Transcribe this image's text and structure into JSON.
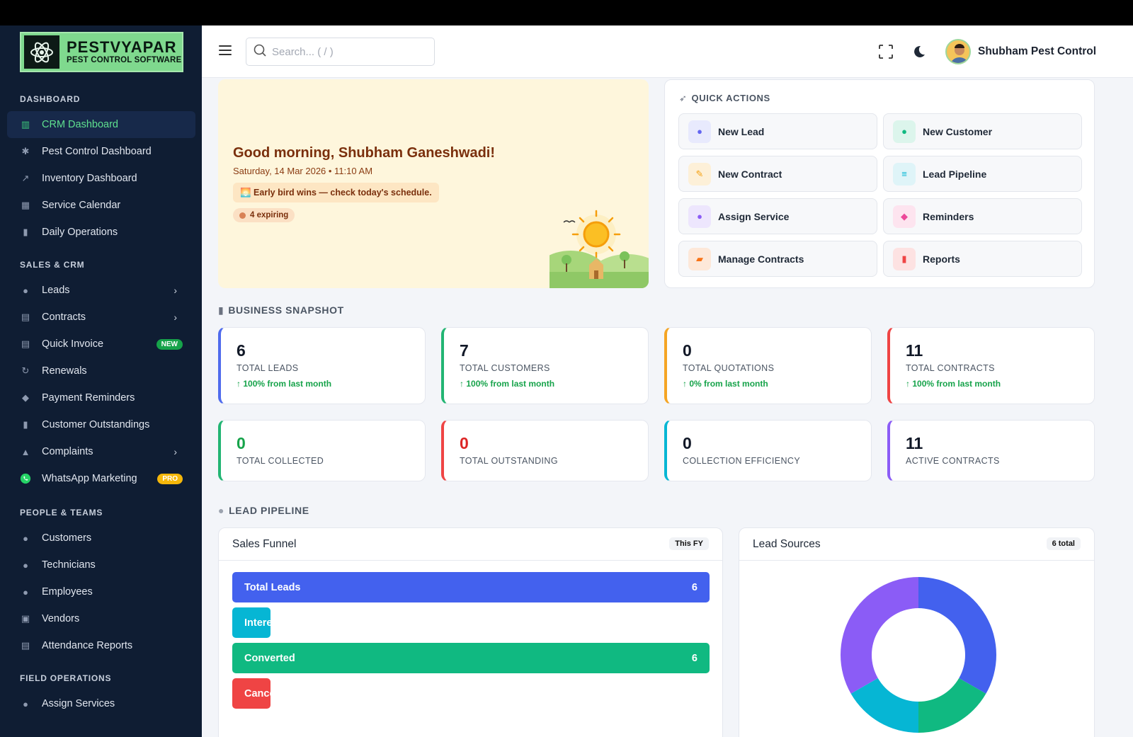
{
  "brand": {
    "line1": "PESTVYAPAR",
    "line2": "PEST CONTROL SOFTWARE"
  },
  "sidebar": {
    "sections": [
      {
        "title": "DASHBOARD",
        "items": [
          {
            "label": "CRM Dashboard",
            "icon": "bar-chart-icon",
            "active": true
          },
          {
            "label": "Pest Control Dashboard",
            "icon": "bug-icon"
          },
          {
            "label": "Inventory Dashboard",
            "icon": "trend-icon"
          },
          {
            "label": "Service Calendar",
            "icon": "calendar-icon"
          },
          {
            "label": "Daily Operations",
            "icon": "bars-icon"
          }
        ]
      },
      {
        "title": "SALES & CRM",
        "items": [
          {
            "label": "Leads",
            "icon": "user-icon",
            "chevron": true
          },
          {
            "label": "Contracts",
            "icon": "document-icon",
            "chevron": true
          },
          {
            "label": "Quick Invoice",
            "icon": "invoice-icon",
            "badge": "NEW"
          },
          {
            "label": "Renewals",
            "icon": "refresh-icon"
          },
          {
            "label": "Payment Reminders",
            "icon": "bell-icon"
          },
          {
            "label": "Customer Outstandings",
            "icon": "bars-icon"
          },
          {
            "label": "Complaints",
            "icon": "warning-icon",
            "chevron": true
          },
          {
            "label": "WhatsApp Marketing",
            "icon": "whatsapp-icon",
            "badge": "PRO"
          }
        ]
      },
      {
        "title": "PEOPLE & TEAMS",
        "items": [
          {
            "label": "Customers",
            "icon": "users-icon"
          },
          {
            "label": "Technicians",
            "icon": "technician-icon"
          },
          {
            "label": "Employees",
            "icon": "user-icon"
          },
          {
            "label": "Vendors",
            "icon": "vendor-icon"
          },
          {
            "label": "Attendance Reports",
            "icon": "report-icon"
          }
        ]
      },
      {
        "title": "FIELD OPERATIONS",
        "items": [
          {
            "label": "Assign Services",
            "icon": "assign-icon"
          }
        ]
      }
    ]
  },
  "header": {
    "search_placeholder": "Search... ( / )",
    "user_name": "Shubham Pest Control"
  },
  "greeting": {
    "title": "Good morning, Shubham Ganeshwadi!",
    "date": "Saturday, 14 Mar 2026 • 11:10 AM",
    "tip": "🌅 Early bird wins — check today's schedule.",
    "expiring": "4 expiring"
  },
  "quick_actions": {
    "title": "QUICK ACTIONS",
    "items": [
      {
        "label": "New Lead",
        "color": "#6366f1",
        "bg": "#e8eafd"
      },
      {
        "label": "New Customer",
        "color": "#10b981",
        "bg": "#dcf5ec"
      },
      {
        "label": "New Contract",
        "color": "#f59e0b",
        "bg": "#fdf0d8"
      },
      {
        "label": "Lead Pipeline",
        "color": "#06b6d4",
        "bg": "#dff4f8"
      },
      {
        "label": "Assign Service",
        "color": "#8b5cf6",
        "bg": "#ede6fd"
      },
      {
        "label": "Reminders",
        "color": "#ec4899",
        "bg": "#fde4ef"
      },
      {
        "label": "Manage Contracts",
        "color": "#f97316",
        "bg": "#fde8d9"
      },
      {
        "label": "Reports",
        "color": "#ef4444",
        "bg": "#fde2e2"
      }
    ]
  },
  "snapshot": {
    "title": "BUSINESS SNAPSHOT",
    "stats": [
      {
        "value": "6",
        "label": "TOTAL LEADS",
        "trend": "100% from last month",
        "color": "#4f6bed"
      },
      {
        "value": "7",
        "label": "TOTAL CUSTOMERS",
        "trend": "100% from last month",
        "color": "#22b573"
      },
      {
        "value": "0",
        "label": "TOTAL QUOTATIONS",
        "trend": "0% from last month",
        "color": "#f5a524"
      },
      {
        "value": "11",
        "label": "TOTAL CONTRACTS",
        "trend": "100% from last month",
        "color": "#ef4444"
      },
      {
        "value": "0",
        "label": "TOTAL COLLECTED",
        "color": "#22b573",
        "value_color": "#16a34a"
      },
      {
        "value": "0",
        "label": "TOTAL OUTSTANDING",
        "color": "#ef4444",
        "value_color": "#dc2626"
      },
      {
        "value": "0",
        "label": "COLLECTION EFFICIENCY",
        "color": "#06b6d4"
      },
      {
        "value": "11",
        "label": "ACTIVE CONTRACTS",
        "color": "#8b5cf6"
      }
    ]
  },
  "pipeline": {
    "title": "LEAD PIPELINE",
    "funnel": {
      "title": "Sales Funnel",
      "badge": "This FY",
      "bars": [
        {
          "label": "Total Leads",
          "value": "6",
          "fraction": 1.0,
          "color": "#4361ee"
        },
        {
          "label": "Interested",
          "value": "0",
          "fraction": 0.08,
          "color": "#06b6d4"
        },
        {
          "label": "Converted",
          "value": "6",
          "fraction": 1.0,
          "color": "#10b981"
        },
        {
          "label": "Cancelled",
          "value": "0",
          "fraction": 0.08,
          "color": "#ef4444"
        }
      ]
    },
    "sources": {
      "title": "Lead Sources",
      "badge": "6 total",
      "chart_data": {
        "type": "pie",
        "slices": [
          {
            "fraction": 0.333,
            "color": "#4361ee"
          },
          {
            "fraction": 0.167,
            "color": "#10b981"
          },
          {
            "fraction": 0.167,
            "color": "#06b6d4"
          },
          {
            "fraction": 0.333,
            "color": "#8b5cf6"
          }
        ]
      }
    }
  }
}
